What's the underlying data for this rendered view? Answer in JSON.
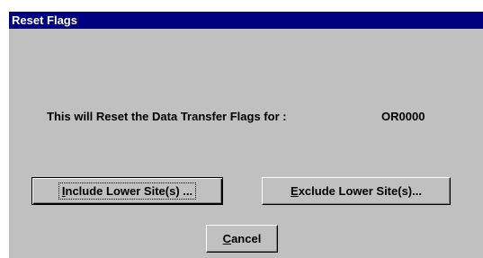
{
  "window": {
    "title": "Reset Flags"
  },
  "dialog": {
    "message": "This will Reset the Data Transfer Flags for :",
    "site_code": "OR0000"
  },
  "buttons": {
    "include": {
      "accel": "I",
      "rest": "nclude Lower Site(s) ..."
    },
    "exclude": {
      "accel": "E",
      "rest": "xclude Lower Site(s)..."
    },
    "cancel": {
      "accel": "C",
      "rest": "ancel"
    }
  },
  "colors": {
    "titlebar": "#000080",
    "title_text": "#ffffff",
    "dialog_face": "#c0c0c0"
  }
}
